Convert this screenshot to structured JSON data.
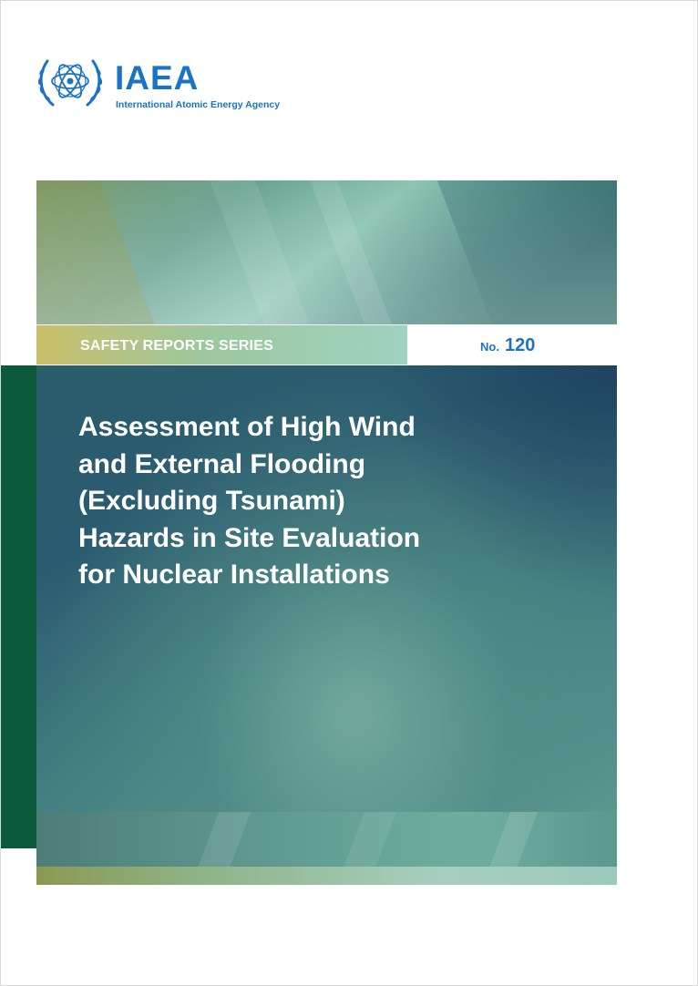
{
  "logo": {
    "wordmark": "IAEA",
    "subtitle": "International Atomic Energy Agency",
    "emblem_icon": "iaea-atom-emblem-icon",
    "color": "#1a73c6"
  },
  "series": {
    "label": "SAFETY REPORTS SERIES",
    "number_prefix": "No.",
    "number": "120"
  },
  "title": {
    "lines": [
      "Assessment of High Wind",
      "and External Flooding",
      "(Excluding Tsunami)",
      "Hazards in Site Evaluation",
      "for Nuclear Installations"
    ]
  },
  "colors": {
    "accent_blue": "#1a73c6",
    "side_bar_green": "#0b5a3b",
    "panel_teal": "#2b5e6b",
    "banner_teal": "#6fae9f"
  }
}
